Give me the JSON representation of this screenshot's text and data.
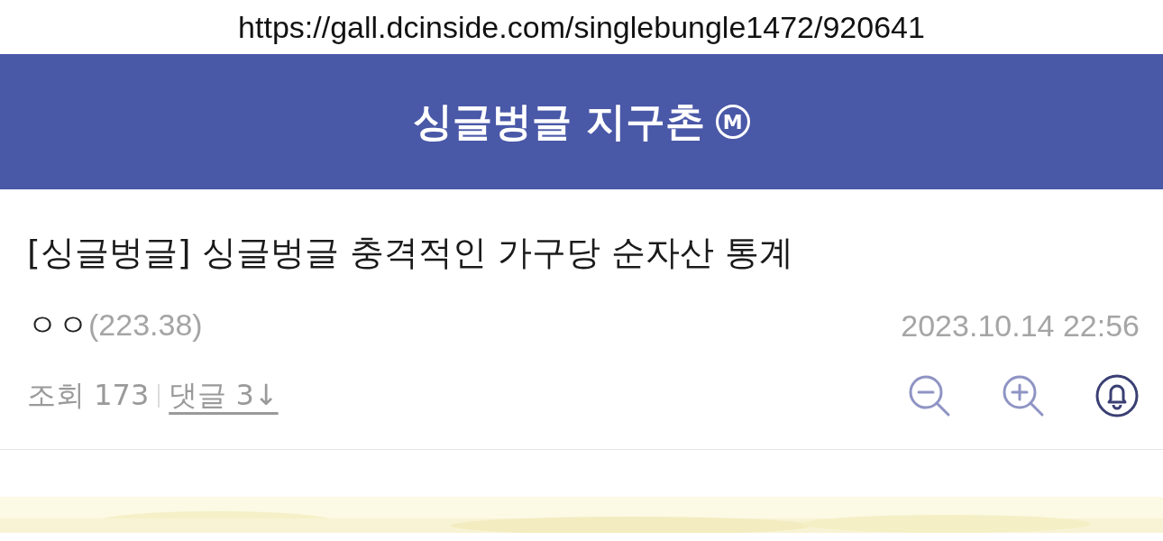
{
  "address_bar": {
    "url": "https://gall.dcinside.com/singlebungle1472/920641"
  },
  "header": {
    "title": "싱글벙글 지구촌",
    "badge": "M"
  },
  "post": {
    "title": "[싱글벙글] 싱글벙글 충격적인 가구당 순자산 통계",
    "author": "ㅇㅇ",
    "ip": "(223.38)",
    "date": "2023.10.14 22:56",
    "views": "조회 173",
    "comments": "댓글 3↓"
  }
}
